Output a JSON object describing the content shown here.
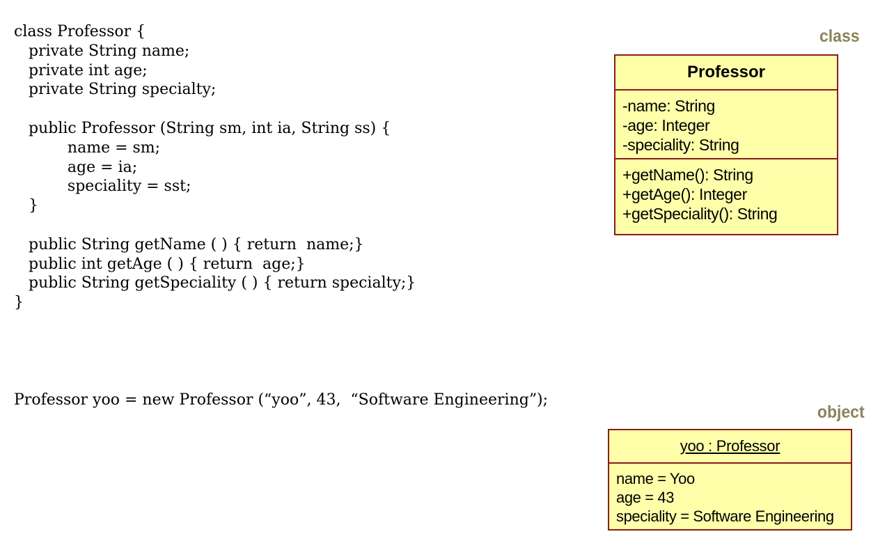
{
  "code_class": {
    "lines": [
      "class Professor {",
      "   private String name;",
      "   private int age;",
      "   private String specialty;",
      "",
      "   public Professor (String sm, int ia, String ss) {",
      "           name = sm;",
      "           age = ia;",
      "           speciality = sst;",
      "   }",
      "",
      "   public String getName ( ) { return  name;}",
      "   public int getAge ( ) { return  age;}",
      "   public String getSpeciality ( ) { return specialty;}",
      "}"
    ]
  },
  "code_object": {
    "line": "Professor yoo = new Professor (“yoo”, 43,  “Software Engineering”);"
  },
  "labels": {
    "class": "class",
    "object": "object"
  },
  "uml_class": {
    "name": "Professor",
    "attributes": [
      "-name: String",
      "-age: Integer",
      "-speciality: String"
    ],
    "operations": [
      "+getName(): String",
      "+getAge(): Integer",
      "+getSpeciality(): String"
    ]
  },
  "uml_object": {
    "title": "yoo : Professor",
    "slots": [
      "name = Yoo",
      "age = 43",
      "speciality = Software Engineering"
    ]
  },
  "colors": {
    "box_fill": "#ffffaa",
    "box_border": "#8b1a1a",
    "label_color": "#8b835a"
  }
}
